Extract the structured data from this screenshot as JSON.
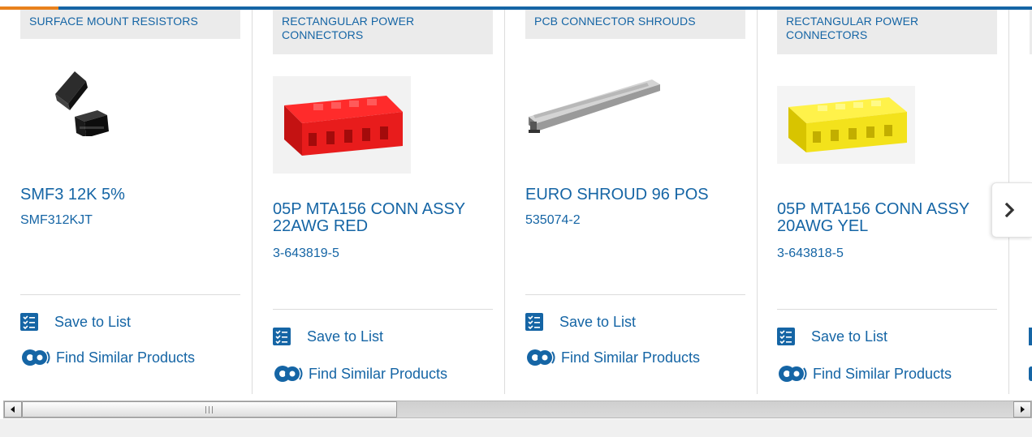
{
  "carousel": {
    "cards": [
      {
        "category": "SURFACE MOUNT RESISTORS",
        "name": "SMF3 12K 5%",
        "part_number": "SMF312KJT",
        "image": "black-smd-resistor",
        "save_label": "Save to List",
        "find_label": "Find Similar Products"
      },
      {
        "category": "RECTANGULAR POWER CONNECTORS",
        "name": "05P MTA156 CONN ASSY 22AWG RED",
        "part_number": "3-643819-5",
        "image": "red-connector",
        "save_label": "Save to List",
        "find_label": "Find Similar Products"
      },
      {
        "category": "PCB CONNECTOR SHROUDS",
        "name": "EURO SHROUD 96 POS",
        "part_number": "535074-2",
        "image": "gray-shroud",
        "save_label": "Save to List",
        "find_label": "Find Similar Products"
      },
      {
        "category": "RECTANGULAR POWER CONNECTORS",
        "name": "05P MTA156 CONN ASSY 20AWG YEL",
        "part_number": "3-643818-5",
        "image": "yellow-connector",
        "save_label": "Save to List",
        "find_label": "Find Similar Products"
      }
    ],
    "next_icon": "chevron-right-icon"
  },
  "colors": {
    "link": "#1565a5",
    "accent_bar": "#1565a5",
    "accent_orange": "#e8811d",
    "tag_background": "#ebebeb"
  }
}
